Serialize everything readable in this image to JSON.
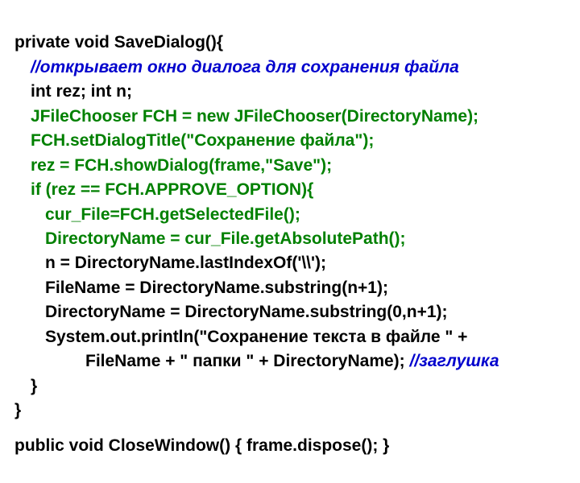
{
  "lines": {
    "l0": "private void SaveDialog(){",
    "l1": "//открывает окно диалога для сохранения файла",
    "l2": "int rez; int n;",
    "l3": "JFileChooser FCH = new JFileChooser(DirectoryName);",
    "l4": "FCH.setDialogTitle(\"Сохранение файла\");",
    "l5": "rez = FCH.showDialog(frame,\"Save\");",
    "l6": "if (rez == FCH.APPROVE_OPTION){",
    "l7": "cur_File=FCH.getSelectedFile();",
    "l8": "DirectoryName = cur_File.getAbsolutePath();",
    "l9": "n = DirectoryName.lastIndexOf('\\\\');",
    "l10": "FileName = DirectoryName.substring(n+1);",
    "l11": "DirectoryName = DirectoryName.substring(0,n+1);",
    "l12": "System.out.println(\"Сохранение текста в файле \" +",
    "l13a": "FileName + \" папки \" + DirectoryName); ",
    "l13b": "//заглушка",
    "l14": "}",
    "l15": "}",
    "l16": "public void CloseWindow() { frame.dispose(); }"
  }
}
